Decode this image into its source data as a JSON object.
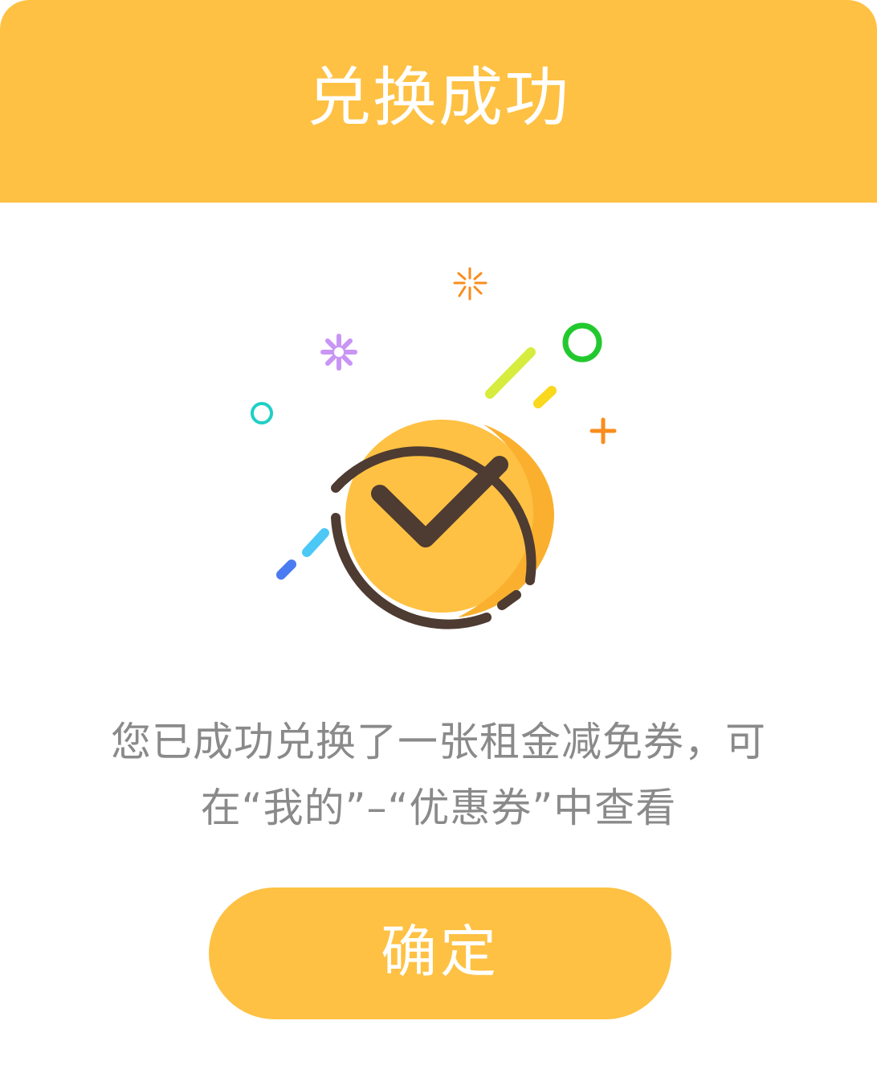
{
  "header": {
    "title": "兑换成功"
  },
  "illustration": {
    "icon": "check-circle-icon",
    "accent_color": "#FEC143",
    "outline_color": "#4E3B31"
  },
  "message": {
    "line1": "您已成功兑换了一张租金减免券，可",
    "line2": "在“我的”–“优惠券”中查看"
  },
  "confirm_button": {
    "label": "确定"
  },
  "colors": {
    "brand": "#FEC143",
    "text_muted": "#8a8a8a",
    "white": "#ffffff"
  }
}
